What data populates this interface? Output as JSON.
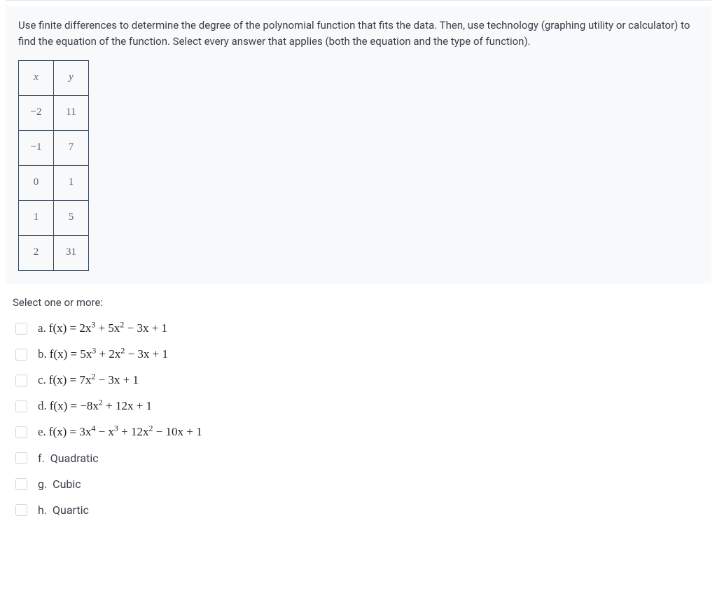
{
  "question": "Use finite differences to determine the degree of the polynomial function that fits the data. Then, use technology (graphing utility or calculator) to find the equation of the function. Select every answer that applies (both the equation and the type of function).",
  "table": {
    "headers": {
      "x": "x",
      "y": "y"
    },
    "rows": [
      {
        "x": "−2",
        "y": "11"
      },
      {
        "x": "−1",
        "y": "7"
      },
      {
        "x": "0",
        "y": "1"
      },
      {
        "x": "1",
        "y": "5"
      },
      {
        "x": "2",
        "y": "31"
      }
    ]
  },
  "select_prompt": "Select one or more:",
  "options": {
    "a": {
      "letter": "a.",
      "fx": "f(x) = 2x",
      "e1": "3",
      "t2": " + 5x",
      "e2": "2",
      "t3": " − 3x + 1"
    },
    "b": {
      "letter": "b.",
      "fx": "f(x) = 5x",
      "e1": "3",
      "t2": " + 2x",
      "e2": "2",
      "t3": " − 3x + 1"
    },
    "c": {
      "letter": "c.",
      "fx": "f(x) = 7x",
      "e1": "2",
      "t2": " − 3x + 1",
      "e2": "",
      "t3": ""
    },
    "d": {
      "letter": "d.",
      "fx": "f(x) = −8x",
      "e1": "2",
      "t2": " + 12x + 1",
      "e2": "",
      "t3": ""
    },
    "e": {
      "letter": "e.",
      "fx": "f(x) = 3x",
      "e1": "4",
      "t2": " − x",
      "e2": "3",
      "t3": " + 12x",
      "e3x": "2",
      "t4": " − 10x + 1"
    },
    "f": {
      "letter": "f.",
      "text": "Quadratic"
    },
    "g": {
      "letter": "g.",
      "text": "Cubic"
    },
    "h": {
      "letter": "h.",
      "text": "Quartic"
    }
  }
}
